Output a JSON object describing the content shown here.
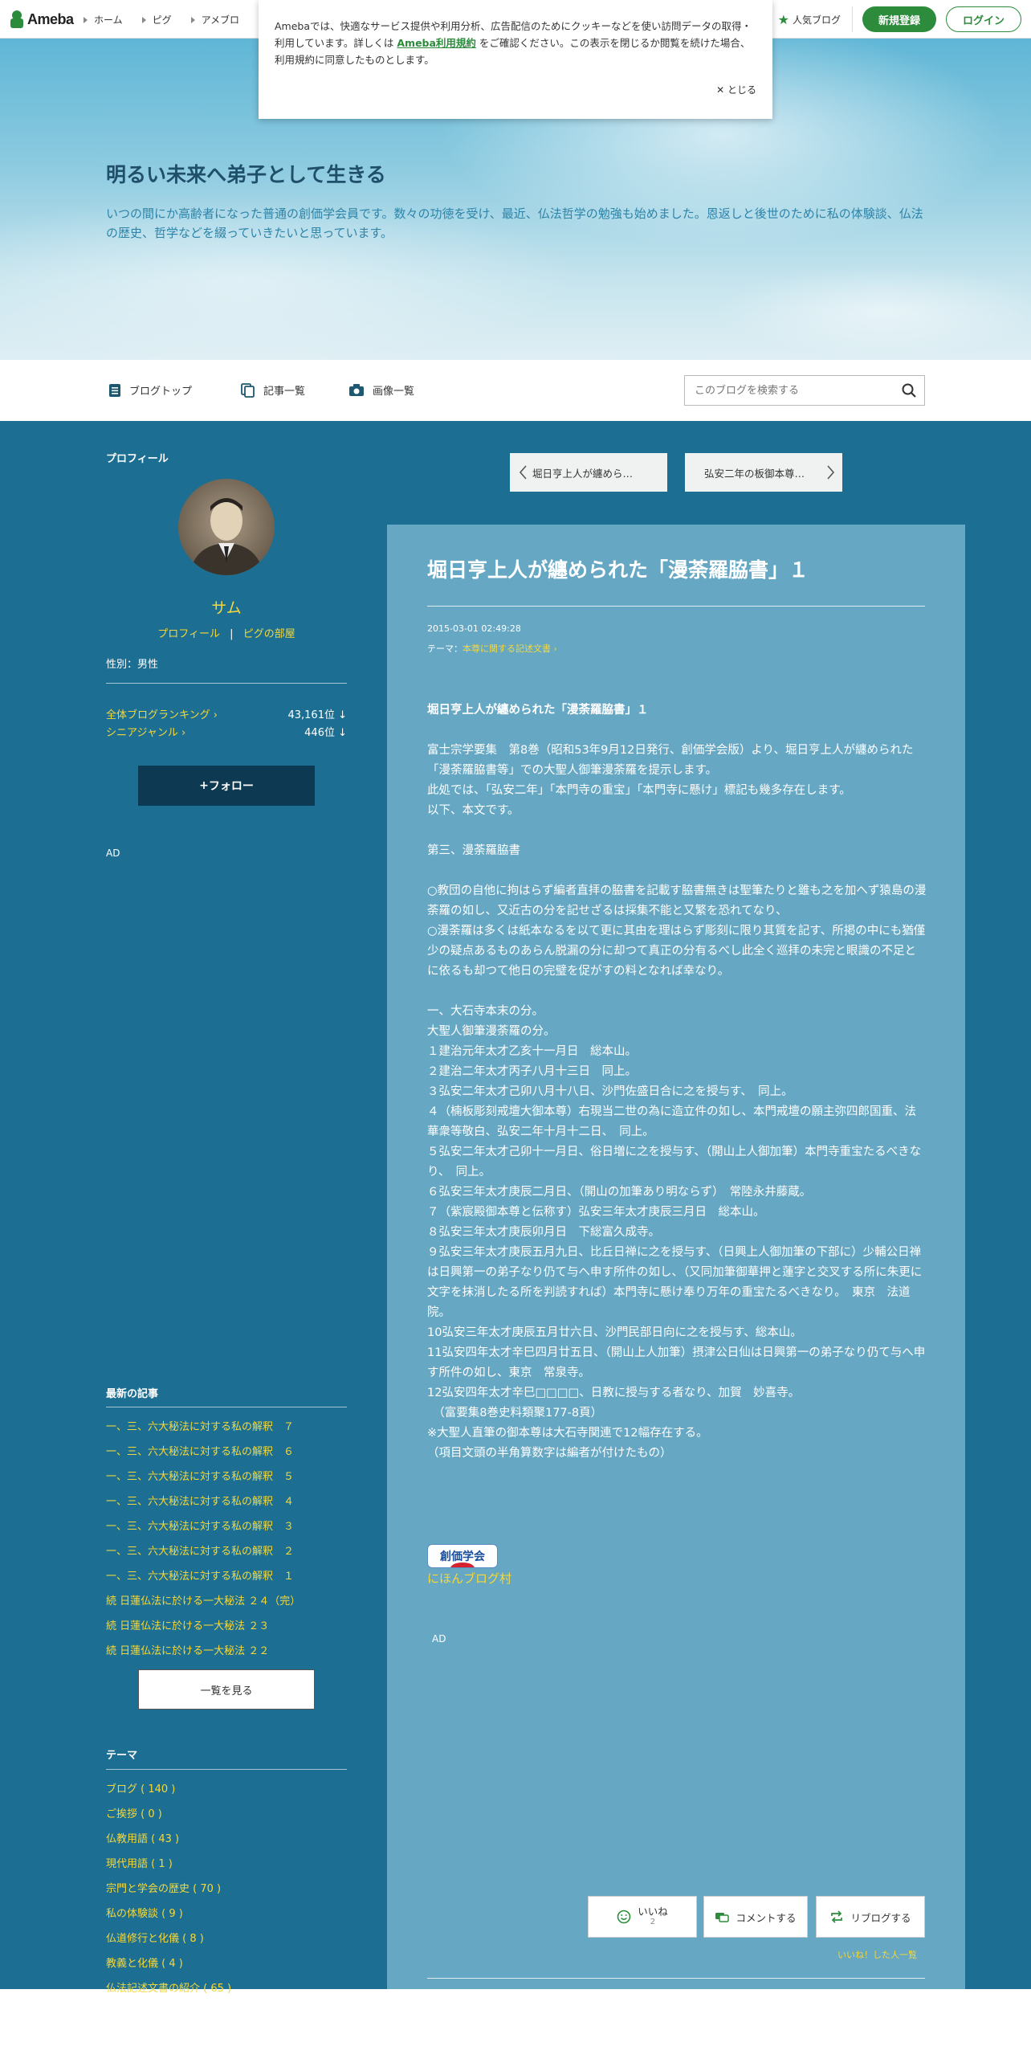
{
  "topbar": {
    "logo": "Ameba",
    "nav": [
      "ホーム",
      "ピグ",
      "アメブロ"
    ],
    "popular": "人気ブログ",
    "register": "新規登録",
    "login": "ログイン"
  },
  "cookie": {
    "text1": "Amebaでは、快適なサービス提供や利用分析、広告配信のためにクッキーなどを使い訪問データの取得・利用しています。詳しくは",
    "link": "Ameba利用規約",
    "text2": "をご確認ください。この表示を閉じるか閲覧を続けた場合、利用規約に同意したものとします。",
    "close": "とじる"
  },
  "header": {
    "title": "明るい未来へ弟子として生きる",
    "description": "いつの間にか高齢者になった普通の創価学会員です。数々の功徳を受け、最近、仏法哲学の勉強も始めました。恩返しと後世のために私の体験談、仏法の歴史、哲学などを綴っていきたいと思っています。"
  },
  "subnav": {
    "blog_top": "ブログトップ",
    "entries": "記事一覧",
    "images": "画像一覧",
    "search_placeholder": "このブログを検索する"
  },
  "sidebar": {
    "profile_heading": "プロフィール",
    "name": "サム",
    "profile_link": "プロフィール",
    "pigg_link": "ピグの部屋",
    "sep": "|",
    "gender": "性別：男性",
    "rank_all_label": "全体ブログランキング",
    "rank_all_value": "43,161位 ↓",
    "rank_senior_label": "シニアジャンル",
    "rank_senior_value": "446位 ↓",
    "follow": "フォロー",
    "ad": "AD",
    "recent_heading": "最新の記事",
    "recent": [
      "一、三、六大秘法に対する私の解釈　７",
      "一、三、六大秘法に対する私の解釈　６",
      "一、三、六大秘法に対する私の解釈　５",
      "一、三、六大秘法に対する私の解釈　４",
      "一、三、六大秘法に対する私の解釈　３",
      "一、三、六大秘法に対する私の解釈　２",
      "一、三、六大秘法に対する私の解釈　１",
      "続 日蓮仏法に於ける一大秘法 ２４（完）",
      "続 日蓮仏法に於ける一大秘法 ２３",
      "続 日蓮仏法に於ける一大秘法 ２２"
    ],
    "all_button": "一覧を見る",
    "theme_heading": "テーマ",
    "themes": [
      "ブログ ( 140 )",
      "ご挨拶 ( 0 )",
      "仏教用語 ( 43 )",
      "現代用語 ( 1 )",
      "宗門と学会の歴史 ( 70 )",
      "私の体験談 ( 9 )",
      "仏道修行と化儀 ( 8 )",
      "教義と化儀 ( 4 )",
      "仏法記述文書の紹介 ( 65 )"
    ]
  },
  "pager": {
    "prev": "堀日亨上人が纏めら…",
    "next": "弘安二年の板御本尊…"
  },
  "article": {
    "title": "堀日亨上人が纏められた「漫荼羅脇書」１",
    "date": "2015-03-01 02:49:28",
    "theme_label": "テーマ：",
    "theme": "本尊に関する記述文書",
    "bold_heading": "堀日亨上人が纏められた「漫荼羅脇書」１",
    "paragraphs": [
      "富士宗学要集　第8巻（昭和53年9月12日発行、創価学会版）より、堀日亨上人が纏められた「漫荼羅脇書等」での大聖人御筆漫荼羅を提示します。\n此処では、「弘安二年」「本門寺の重宝」「本門寺に懸け」標記も幾多存在します。\n以下、本文です。",
      "第三、漫荼羅脇書",
      "○教団の自他に拘はらず編者直拝の脇書を記載す脇書無きは聖筆たりと雖も之を加へず猿島の漫荼羅の如し、又近古の分を記せざるは採集不能と又繁を恐れてなり、\n○漫荼羅は多くは紙本なるを以て更に其由を理はらず彫刻に限り其質を記す、所掲の中にも猶僅少の疑点あるものあらん脱漏の分に却つて真正の分有るべし此全く巡拝の未完と眼識の不足とに依るも却つて他日の完璧を促がすの料となれば幸なり。",
      "一、大石寺本末の分。\n大聖人御筆漫荼羅の分。\n１建治元年太才乙亥十一月日　総本山。\n２建治二年太才丙子八月十三日　同上。\n３弘安二年太才己卯八月十八日、沙門佐盛日合に之を授与す、　同上。\n４（楠板彫刻戒壇大御本尊）右現当二世の為に造立件の如し、本門戒壇の願主弥四郎国重、法華衆等敬白、弘安二年十月十二日、　同上。\n５弘安二年太才己卯十一月日、俗日増に之を授与す、（開山上人御加筆）本門寺重宝たるべきなり、　同上。\n６弘安三年太才庚辰二月日、（開山の加筆あり明ならず）　常陸永井藤蔵。\n７（紫宸殿御本尊と伝称す）弘安三年太才庚辰三月日　総本山。\n８弘安三年太才庚辰卯月日　下総富久成寺。\n９弘安三年太才庚辰五月九日、比丘日禅に之を授与す、（日興上人御加筆の下部に）少輔公日禅は日興第一の弟子なり仍て与へ申す所件の如し、（又同加筆御華押と蓮字と交叉する所に朱更に文字を抹消したる所を判読すれば）本門寺に懸け奉り万年の重宝たるべきなり。　東京　法道院。\n10弘安三年太才庚辰五月廿六日、沙門民部日向に之を授与す、総本山。\n11弘安四年太才辛巳四月廿五日、（開山上人加筆）摂津公日仙は日興第一の弟子なり仍て与へ申す所件の如し、東京　常泉寺。\n12弘安四年太才辛巳□□□□、日教に授与する者なり、加賀　妙喜寺。\n　（富要集8巻史料類聚177-8頁）\n※大聖人直筆の御本尊は大石寺関連で12幅存在する。\n（項目文頭の半角算数字は編者が付けたもの）"
    ],
    "badge": "創価学会",
    "nihon_blog": "にほんブログ村",
    "ad": "AD",
    "like": "いいね",
    "like_count": "2",
    "comment": "コメントする",
    "reblog": "リブログする",
    "like_list": "いいね！した人一覧"
  }
}
